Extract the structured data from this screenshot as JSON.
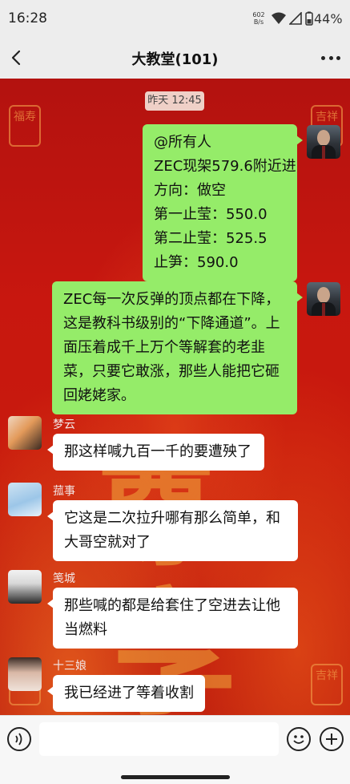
{
  "status_bar": {
    "time": "16:28",
    "net_speed": "602",
    "net_unit": "B/s",
    "battery": "44%"
  },
  "header": {
    "title": "大教堂(101)"
  },
  "chat": {
    "timestamp": "昨天 12:45",
    "self_messages": [
      {
        "lines": [
          "@所有人",
          "ZEC现架579.6附近进",
          "方向：做空",
          "第一止莹：550.0",
          "第二止莹：525.5",
          "止笋：590.0"
        ]
      },
      {
        "lines": [
          "ZEC每一次反弹的顶点都在下降，",
          "这是教科书级别的“下降通道”。上",
          "面压着成千上万个等解套的老韭",
          "菜，只要它敢涨，那些人能把它砸",
          "回姥姥家。"
        ]
      }
    ],
    "other_messages": [
      {
        "sender": "梦云",
        "lines": [
          "那这样喊九百一千的要遭殃了"
        ]
      },
      {
        "sender": "菰事",
        "lines": [
          "它这是二次拉升哪有那么简单，和",
          "大哥空就对了"
        ]
      },
      {
        "sender": "笺城",
        "lines": [
          "那些喊的都是给套住了空进去让他",
          "当燃料"
        ]
      },
      {
        "sender": "十三娘",
        "lines": [
          "我已经进了等着收割"
        ]
      }
    ],
    "wallpaper_chars": [
      "尊",
      "享"
    ],
    "wallpaper_seal_left": "福寿",
    "wallpaper_seal_right": "吉祥"
  },
  "input_bar": {
    "placeholder": ""
  },
  "colors": {
    "self_bubble": "#95ec69",
    "other_bubble": "#ffffff",
    "chat_background": "#c8170f"
  }
}
